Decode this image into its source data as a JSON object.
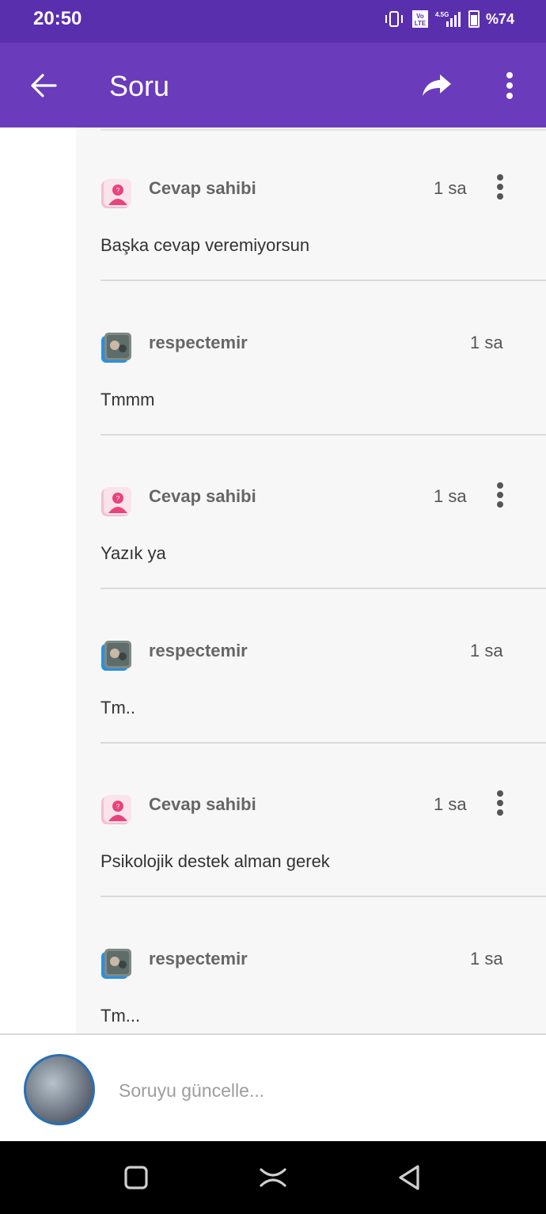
{
  "status": {
    "time": "20:50",
    "battery": "%74"
  },
  "app_bar": {
    "title": "Soru"
  },
  "comments": [
    {
      "author": "Cevap sahibi",
      "time": "1 sa",
      "text": "Başka cevap veremiyorsun",
      "type": "owner"
    },
    {
      "author": "respectemir",
      "time": "1 sa",
      "text": "Tmmm",
      "type": "user"
    },
    {
      "author": "Cevap sahibi",
      "time": "1 sa",
      "text": "Yazık ya",
      "type": "owner"
    },
    {
      "author": "respectemir",
      "time": "1 sa",
      "text": "Tm..",
      "type": "user"
    },
    {
      "author": "Cevap sahibi",
      "time": "1 sa",
      "text": "Psikolojik destek alman gerek",
      "type": "owner"
    },
    {
      "author": "respectemir",
      "time": "1 sa",
      "text": "Tm...",
      "type": "user"
    }
  ],
  "input": {
    "placeholder": "Soruyu güncelle..."
  },
  "colors": {
    "status_bar": "#5a2fae",
    "app_bar": "#6a3bbb",
    "owner_avatar": "#e8447a",
    "user_avatar_ring": "#2a8fe0"
  }
}
